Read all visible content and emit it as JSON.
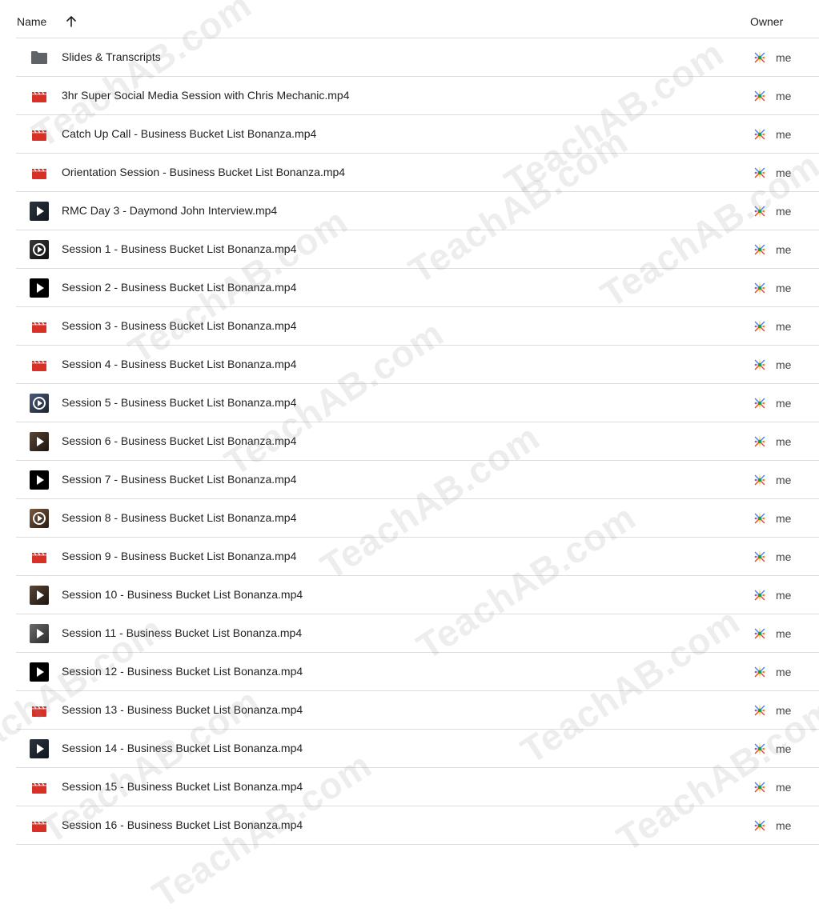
{
  "header": {
    "name_label": "Name",
    "owner_label": "Owner",
    "sort_icon": "arrow-up-icon"
  },
  "files": [
    {
      "name": "Slides & Transcripts",
      "icon": "folder-icon",
      "thumb": "folder",
      "owner": "me"
    },
    {
      "name": "3hr Super Social Media Session with Chris Mechanic.mp4",
      "icon": "video-file-icon",
      "thumb": "clapper",
      "owner": "me"
    },
    {
      "name": "Catch Up Call - Business Bucket List Bonanza.mp4",
      "icon": "video-file-icon",
      "thumb": "clapper",
      "owner": "me"
    },
    {
      "name": "Orientation Session - Business Bucket List Bonanza.mp4",
      "icon": "video-file-icon",
      "thumb": "clapper",
      "owner": "me"
    },
    {
      "name": "RMC Day 3 - Daymond John Interview.mp4",
      "icon": "video-thumbnail-icon",
      "thumb": "play-dark",
      "owner": "me"
    },
    {
      "name": "Session 1 - Business Bucket List Bonanza.mp4",
      "icon": "video-thumbnail-icon",
      "thumb": "circle-dark",
      "owner": "me"
    },
    {
      "name": "Session 2 - Business Bucket List Bonanza.mp4",
      "icon": "video-thumbnail-icon",
      "thumb": "play-black",
      "owner": "me"
    },
    {
      "name": "Session 3 - Business Bucket List Bonanza.mp4",
      "icon": "video-file-icon",
      "thumb": "clapper",
      "owner": "me"
    },
    {
      "name": "Session 4 - Business Bucket List Bonanza.mp4",
      "icon": "video-file-icon",
      "thumb": "clapper",
      "owner": "me"
    },
    {
      "name": "Session 5 - Business Bucket List Bonanza.mp4",
      "icon": "video-thumbnail-icon",
      "thumb": "circle-blue",
      "owner": "me"
    },
    {
      "name": "Session 6 - Business Bucket List Bonanza.mp4",
      "icon": "video-thumbnail-icon",
      "thumb": "play-brown",
      "owner": "me"
    },
    {
      "name": "Session 7 - Business Bucket List Bonanza.mp4",
      "icon": "video-thumbnail-icon",
      "thumb": "play-black",
      "owner": "me"
    },
    {
      "name": "Session 8 - Business Bucket List Bonanza.mp4",
      "icon": "video-thumbnail-icon",
      "thumb": "circle-brown",
      "owner": "me"
    },
    {
      "name": "Session 9 - Business Bucket List Bonanza.mp4",
      "icon": "video-file-icon",
      "thumb": "clapper",
      "owner": "me"
    },
    {
      "name": "Session 10 - Business Bucket List Bonanza.mp4",
      "icon": "video-thumbnail-icon",
      "thumb": "play-brown",
      "owner": "me"
    },
    {
      "name": "Session 11 - Business Bucket List Bonanza.mp4",
      "icon": "video-thumbnail-icon",
      "thumb": "play-grey",
      "owner": "me"
    },
    {
      "name": "Session 12 - Business Bucket List Bonanza.mp4",
      "icon": "video-thumbnail-icon",
      "thumb": "play-black",
      "owner": "me"
    },
    {
      "name": "Session 13 - Business Bucket List Bonanza.mp4",
      "icon": "video-file-icon",
      "thumb": "clapper",
      "owner": "me"
    },
    {
      "name": "Session 14 - Business Bucket List Bonanza.mp4",
      "icon": "video-thumbnail-icon",
      "thumb": "play-dark",
      "owner": "me"
    },
    {
      "name": "Session 15 - Business Bucket List Bonanza.mp4",
      "icon": "video-file-icon",
      "thumb": "clapper",
      "owner": "me"
    },
    {
      "name": "Session 16 - Business Bucket List Bonanza.mp4",
      "icon": "video-file-icon",
      "thumb": "clapper",
      "owner": "me"
    }
  ],
  "watermark_text": "TeachAB.com",
  "colors": {
    "folder": "#5f6368",
    "video_red": "#d93025",
    "divider": "#dadce0",
    "text": "#1f1f1f",
    "owner_text": "#444746"
  }
}
